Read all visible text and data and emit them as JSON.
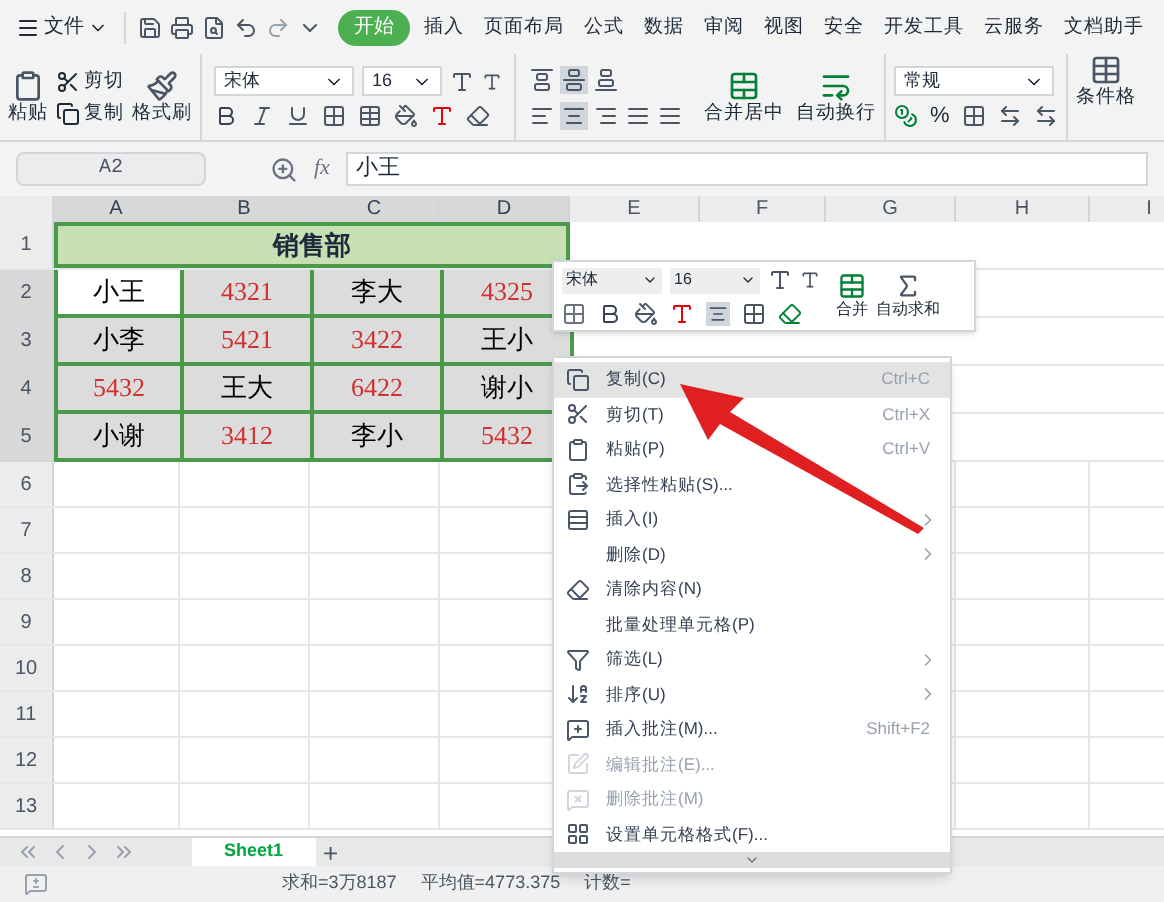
{
  "menu_bar": {
    "file": "文件",
    "tabs": [
      {
        "label": "开始",
        "selected": true
      },
      {
        "label": "插入",
        "selected": false
      },
      {
        "label": "页面布局",
        "selected": false
      },
      {
        "label": "公式",
        "selected": false
      },
      {
        "label": "数据",
        "selected": false
      },
      {
        "label": "审阅",
        "selected": false
      },
      {
        "label": "视图",
        "selected": false
      },
      {
        "label": "安全",
        "selected": false
      },
      {
        "label": "开发工具",
        "selected": false
      },
      {
        "label": "云服务",
        "selected": false
      },
      {
        "label": "文档助手",
        "selected": false
      }
    ]
  },
  "ribbon": {
    "paste": "粘贴",
    "cut": "剪切",
    "copy": "复制",
    "format_painter": "格式刷",
    "font_name": "宋体",
    "font_size": "16",
    "vertical_align": [
      {
        "selected": false
      },
      {
        "selected": true
      },
      {
        "selected": false
      }
    ],
    "horizontal_align": [
      {
        "selected": false
      },
      {
        "selected": true
      },
      {
        "selected": false
      },
      {
        "selected": false
      },
      {
        "selected": false
      }
    ],
    "merge": "合并居中",
    "wrap": "自动换行",
    "number_format": "常规",
    "percent": "%",
    "conditional": "条件格"
  },
  "formula_bar": {
    "cell_ref": "A2",
    "fx": "fx",
    "value": "小王"
  },
  "columns": [
    {
      "label": "A",
      "selected": true
    },
    {
      "label": "B",
      "selected": true
    },
    {
      "label": "C",
      "selected": true
    },
    {
      "label": "D",
      "selected": true
    },
    {
      "label": "E",
      "selected": false
    },
    {
      "label": "F",
      "selected": false
    },
    {
      "label": "G",
      "selected": false
    },
    {
      "label": "H",
      "selected": false
    },
    {
      "label": "I",
      "selected": false
    }
  ],
  "title_row": {
    "label": "1",
    "text": "销售部"
  },
  "rows": [
    {
      "label": "2",
      "selected": true,
      "cells": [
        {
          "text": "小王",
          "color": "#000000",
          "active": true
        },
        {
          "text": "4321",
          "color": "#d03030",
          "active": false
        },
        {
          "text": "李大",
          "color": "#000000",
          "active": false
        },
        {
          "text": "4325",
          "color": "#d03030",
          "active": false
        }
      ]
    },
    {
      "label": "3",
      "selected": true,
      "cells": [
        {
          "text": "小李",
          "color": "#000000",
          "active": false
        },
        {
          "text": "5421",
          "color": "#d03030",
          "active": false
        },
        {
          "text": "3422",
          "color": "#d03030",
          "active": false
        },
        {
          "text": "王小",
          "color": "#000000",
          "active": false
        }
      ]
    },
    {
      "label": "4",
      "selected": true,
      "cells": [
        {
          "text": "5432",
          "color": "#d03030",
          "active": false
        },
        {
          "text": "王大",
          "color": "#000000",
          "active": false
        },
        {
          "text": "6422",
          "color": "#d03030",
          "active": false
        },
        {
          "text": "谢小",
          "color": "#000000",
          "active": false
        }
      ]
    },
    {
      "label": "5",
      "selected": true,
      "cells": [
        {
          "text": "小谢",
          "color": "#000000",
          "active": false
        },
        {
          "text": "3412",
          "color": "#d03030",
          "active": false
        },
        {
          "text": "李小",
          "color": "#000000",
          "active": false
        },
        {
          "text": "5432",
          "color": "#d03030",
          "active": false
        }
      ]
    }
  ],
  "empty_rows": [
    "6",
    "7",
    "8",
    "9",
    "10",
    "11",
    "12",
    "13"
  ],
  "mini_toolbar": {
    "font_name": "宋体",
    "font_size": "16",
    "merge": "合并",
    "autosum": "自动求和"
  },
  "context_menu": [
    {
      "label": "复制(C)",
      "shortcut": "Ctrl+C",
      "selected": true,
      "disabled": false,
      "submenu": false
    },
    {
      "label": "剪切(T)",
      "shortcut": "Ctrl+X",
      "selected": false,
      "disabled": false,
      "submenu": false
    },
    {
      "label": "粘贴(P)",
      "shortcut": "Ctrl+V",
      "selected": false,
      "disabled": false,
      "submenu": false
    },
    {
      "label": "选择性粘贴(S)...",
      "selected": false,
      "disabled": false,
      "submenu": false
    },
    {
      "label": "插入(I)",
      "selected": false,
      "disabled": false,
      "submenu": true
    },
    {
      "label": "删除(D)",
      "selected": false,
      "disabled": false,
      "submenu": true
    },
    {
      "label": "清除内容(N)",
      "selected": false,
      "disabled": false,
      "submenu": false
    },
    {
      "label": "批量处理单元格(P)",
      "selected": false,
      "disabled": false,
      "submenu": false
    },
    {
      "label": "筛选(L)",
      "selected": false,
      "disabled": false,
      "submenu": true
    },
    {
      "label": "排序(U)",
      "selected": false,
      "disabled": false,
      "submenu": true
    },
    {
      "label": "插入批注(M)...",
      "shortcut": "Shift+F2",
      "selected": false,
      "disabled": false,
      "submenu": false
    },
    {
      "label": "编辑批注(E)...",
      "selected": false,
      "disabled": true,
      "submenu": false
    },
    {
      "label": "删除批注(M)",
      "selected": false,
      "disabled": true,
      "submenu": false
    },
    {
      "label": "设置单元格格式(F)...",
      "selected": false,
      "disabled": false,
      "submenu": false
    }
  ],
  "sheet_tabs": [
    {
      "label": "Sheet1",
      "selected": true
    }
  ],
  "add_sheet": "+",
  "status_bar": [
    "求和=3万8187",
    "平均值=4773.375",
    "计数="
  ]
}
